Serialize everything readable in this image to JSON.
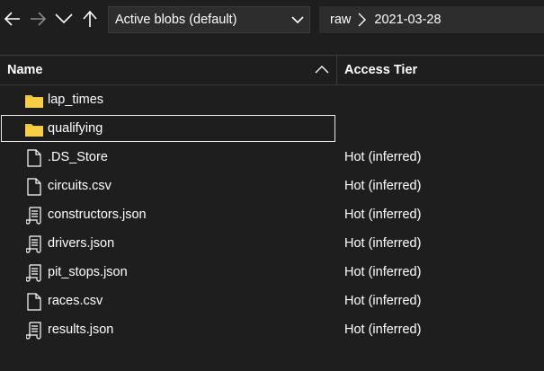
{
  "toolbar": {
    "back_icon": "arrow-left-icon",
    "forward_icon": "arrow-right-icon",
    "recent_icon": "chevron-down-icon",
    "up_icon": "arrow-up-icon"
  },
  "view_selector": {
    "selected": "Active blobs (default)"
  },
  "breadcrumb": {
    "items": [
      "raw",
      "2021-03-28"
    ]
  },
  "columns": {
    "name": "Name",
    "access_tier": "Access Tier"
  },
  "colors": {
    "background": "#1e1e1e",
    "folder": "#f4c430",
    "text": "#ffffff"
  },
  "items": [
    {
      "name": "lap_times",
      "type": "folder",
      "icon": "folder-icon",
      "tier": ""
    },
    {
      "name": "qualifying",
      "type": "folder",
      "icon": "folder-icon",
      "tier": ""
    },
    {
      "name": ".DS_Store",
      "type": "file",
      "icon": "file-icon",
      "tier": "Hot (inferred)"
    },
    {
      "name": "circuits.csv",
      "type": "file",
      "icon": "file-icon",
      "tier": "Hot (inferred)"
    },
    {
      "name": "constructors.json",
      "type": "json",
      "icon": "script-file-icon",
      "tier": "Hot (inferred)"
    },
    {
      "name": "drivers.json",
      "type": "json",
      "icon": "script-file-icon",
      "tier": "Hot (inferred)"
    },
    {
      "name": "pit_stops.json",
      "type": "json",
      "icon": "script-file-icon",
      "tier": "Hot (inferred)"
    },
    {
      "name": "races.csv",
      "type": "file",
      "icon": "file-icon",
      "tier": "Hot (inferred)"
    },
    {
      "name": "results.json",
      "type": "json",
      "icon": "script-file-icon",
      "tier": "Hot (inferred)"
    }
  ]
}
